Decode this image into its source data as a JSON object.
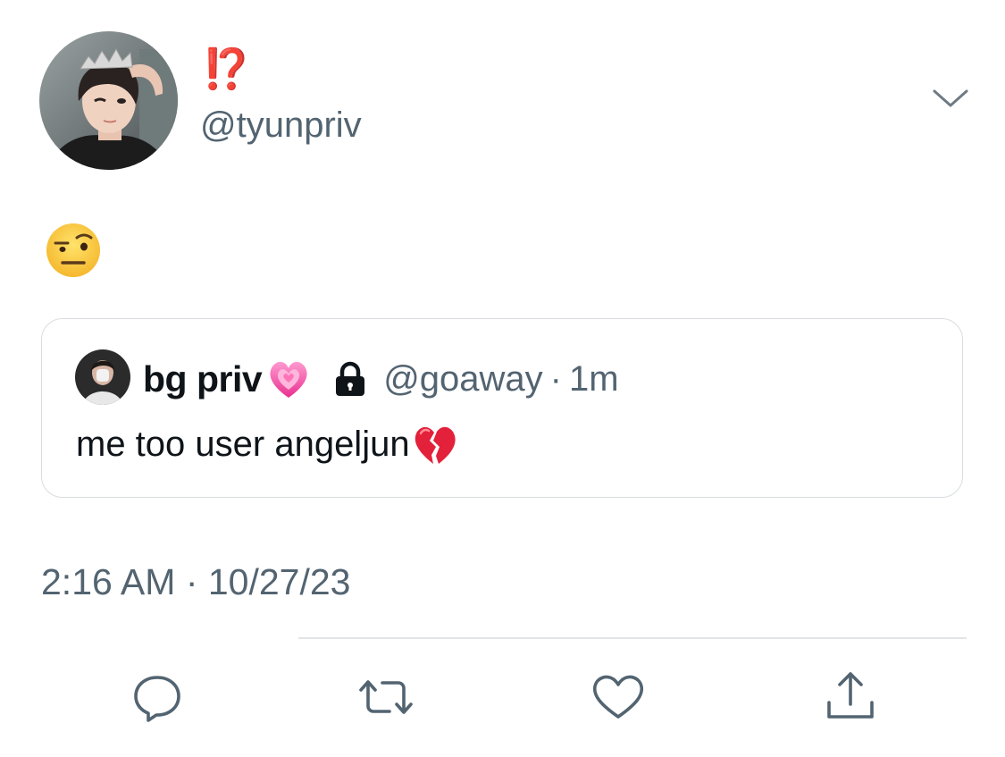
{
  "tweet": {
    "author": {
      "display_name": "⁉️",
      "handle": "@tyunpriv"
    },
    "text_emoji": "face-with-raised-eyebrow",
    "quoted_tweet": {
      "author_name": "bg priv",
      "name_emoji": "growing-heart",
      "protected_icon": "lock-icon",
      "handle": "@goaway",
      "separator": "·",
      "relative_time": "1m",
      "text": "me too user angeljun",
      "text_emoji": "broken-heart"
    },
    "timestamp": "2:16 AM · 10/27/23"
  },
  "actions": [
    {
      "name": "reply",
      "icon": "speech-bubble-icon"
    },
    {
      "name": "retweet",
      "icon": "retweet-icon"
    },
    {
      "name": "like",
      "icon": "heart-icon"
    },
    {
      "name": "share",
      "icon": "share-icon"
    }
  ],
  "colors": {
    "display_name": "#e0341f",
    "secondary_text": "#536471",
    "primary_text": "#0f1419",
    "border": "#d8dde1"
  }
}
